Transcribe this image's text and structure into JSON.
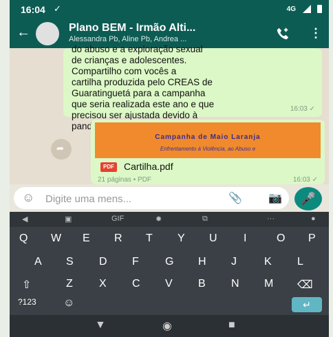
{
  "status": {
    "time": "16:04",
    "network": "4G"
  },
  "header": {
    "back": "←",
    "title": "Plano BEM - Irmão Alti...",
    "subtitle": "Alessandra Pb, Aline Pb, Andrea ..."
  },
  "messages": [
    {
      "text": "do abuso e a exploração sexual\nde crianças e adolescentes.\nCompartilho com vocês a\ncartilha produzida pelo CREAS de\nGuaratinguetá para a campanha\nque seria realizada este ano e que\nprecisou ser ajustada devido à\npandemia.",
      "time": "16:03 ✓"
    },
    {
      "banner_title": "Campanha de Maio Laranja",
      "banner_subtitle": "Enfrentamento à Violência, ao Abuso e",
      "pdf_badge": "PDF",
      "file_name": "Cartilha.pdf",
      "file_meta": "21 páginas • PDF",
      "time": "16:03 ✓"
    }
  ],
  "input": {
    "placeholder": "Digite uma mens..."
  },
  "keyboard": {
    "suggestions": [
      "GIF"
    ],
    "row1": [
      "Q",
      "W",
      "E",
      "R",
      "T",
      "Y",
      "U",
      "I",
      "O",
      "P"
    ],
    "row2": [
      "A",
      "S",
      "D",
      "F",
      "G",
      "H",
      "J",
      "K",
      "L"
    ],
    "row3": [
      "Z",
      "X",
      "C",
      "V",
      "B",
      "N",
      "M"
    ],
    "symbols": "?123"
  },
  "colors": {
    "header": "#0d5c54",
    "bubble": "#dcf8c6",
    "banner": "#f08a2c",
    "mic": "#0d8a7e"
  }
}
